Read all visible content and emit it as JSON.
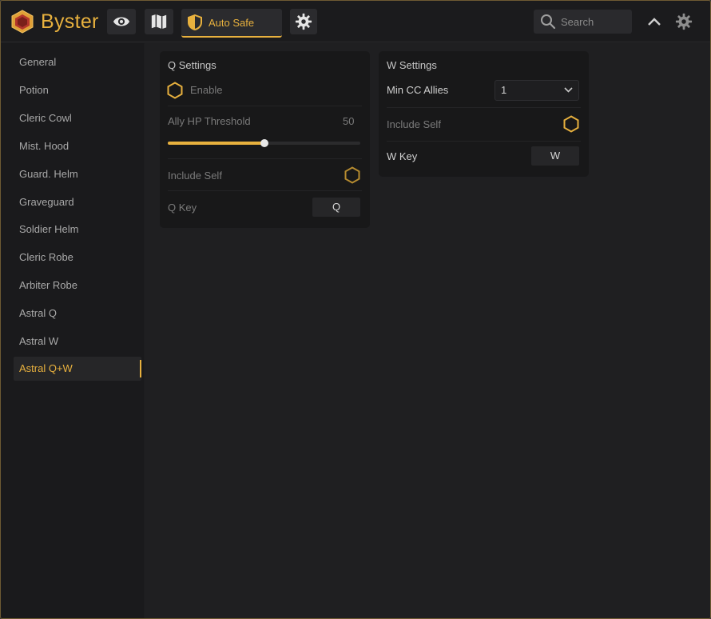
{
  "app": {
    "brand": "Byster",
    "accent": "#e8b13e"
  },
  "header": {
    "tabs": [
      {
        "icon": "eye-icon"
      },
      {
        "icon": "map-icon"
      },
      {
        "icon": "shield-icon",
        "label": "Auto Safe",
        "active": true
      },
      {
        "icon": "gear-icon"
      }
    ],
    "search": {
      "placeholder": "Search",
      "value": ""
    }
  },
  "sidebar": {
    "items": [
      {
        "label": "General"
      },
      {
        "label": "Potion"
      },
      {
        "label": "Cleric Cowl"
      },
      {
        "label": "Mist. Hood"
      },
      {
        "label": "Guard. Helm"
      },
      {
        "label": "Graveguard"
      },
      {
        "label": "Soldier Helm"
      },
      {
        "label": "Cleric Robe"
      },
      {
        "label": "Arbiter Robe"
      },
      {
        "label": "Astral Q"
      },
      {
        "label": "Astral W"
      },
      {
        "label": "Astral Q+W",
        "active": true
      }
    ]
  },
  "q_settings": {
    "title": "Q Settings",
    "enable_label": "Enable",
    "enable_checked": false,
    "threshold_label": "Ally HP Threshold",
    "threshold_value": "50",
    "threshold_fraction": 0.5,
    "include_self_label": "Include Self",
    "include_self_checked": false,
    "key_label": "Q Key",
    "key_value": "Q"
  },
  "w_settings": {
    "title": "W Settings",
    "min_cc_label": "Min CC Allies",
    "min_cc_value": "1",
    "include_self_label": "Include Self",
    "include_self_checked": false,
    "key_label": "W Key",
    "key_value": "W"
  }
}
